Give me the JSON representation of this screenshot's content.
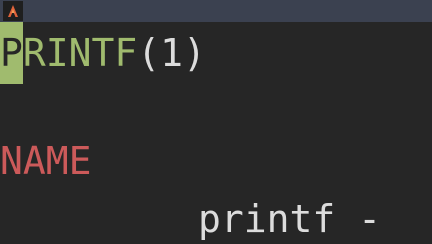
{
  "window": {
    "icon": "alacritty-icon",
    "icon_color": "#e0623a"
  },
  "terminal": {
    "heading_cursor_char": "P",
    "heading_rest": "RINTF",
    "heading_section": "(1)",
    "section_name": "NAME",
    "name_line": "printf -"
  },
  "colors": {
    "background": "#262626",
    "titlebar": "#3b4150",
    "heading": "#a0bb6e",
    "section": "#cc5a5a",
    "text": "#dcdcdc",
    "cursor": "#a0bb6e"
  }
}
